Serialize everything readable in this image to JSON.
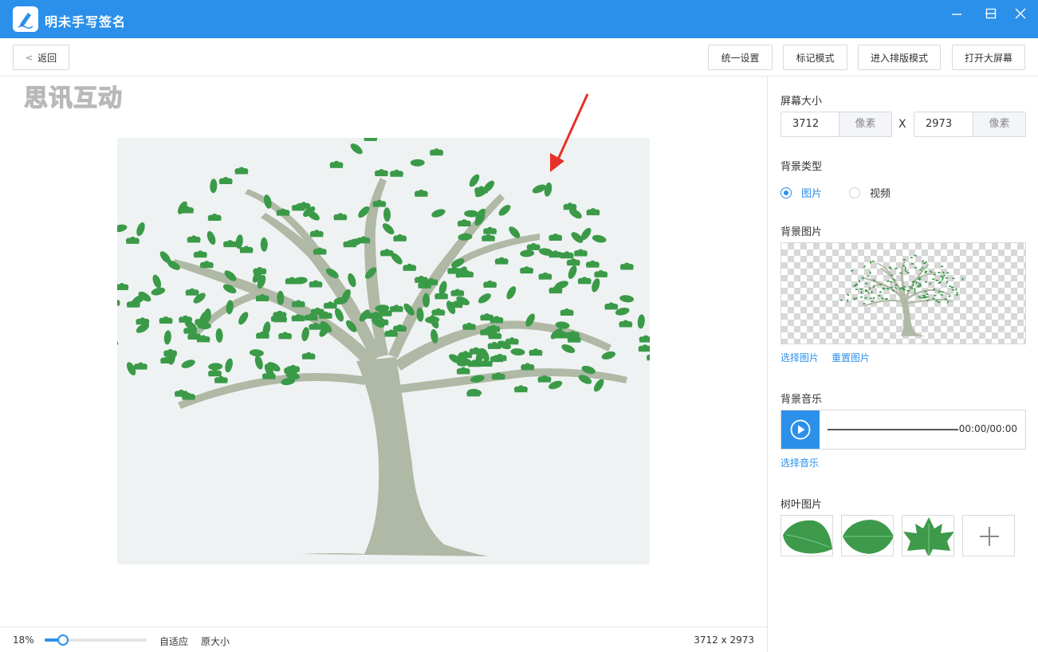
{
  "app": {
    "title": "明未手写签名"
  },
  "toolbar": {
    "back_label": "返回",
    "unified_settings": "统一设置",
    "mark_mode": "标记模式",
    "layout_mode": "进入排版模式",
    "open_big_screen": "打开大屏幕"
  },
  "canvas": {
    "watermark": "思讯互动"
  },
  "bottom": {
    "zoom_percent": "18%",
    "zoom_level": 0.18,
    "fit_label": "自适应",
    "original_label": "原大小",
    "dimensions": "3712 x 2973"
  },
  "panel": {
    "screen_size": {
      "title": "屏幕大小",
      "width": "3712",
      "height": "2973",
      "unit": "像素",
      "separator": "X"
    },
    "bg_type": {
      "title": "背景类型",
      "options": [
        "图片",
        "视频"
      ],
      "selected": "图片"
    },
    "bg_image": {
      "title": "背景图片",
      "choose_label": "选择图片",
      "reset_label": "重置图片"
    },
    "bg_music": {
      "title": "背景音乐",
      "time": "00:00/00:00",
      "choose_label": "选择音乐"
    },
    "leaf_images": {
      "title": "树叶图片"
    }
  },
  "colors": {
    "accent": "#2b90ea",
    "titlebar": "#2b90ea",
    "leaf_green": "#3a9a48",
    "trunk": "#b0b8a6",
    "arrow_red": "#e53228"
  },
  "icons": {
    "app_logo": "pen-logo-icon",
    "minimize": "minimize-icon",
    "maximize": "maximize-icon",
    "close": "close-icon",
    "back": "chevron-left-icon",
    "play": "play-icon",
    "add": "plus-icon"
  }
}
